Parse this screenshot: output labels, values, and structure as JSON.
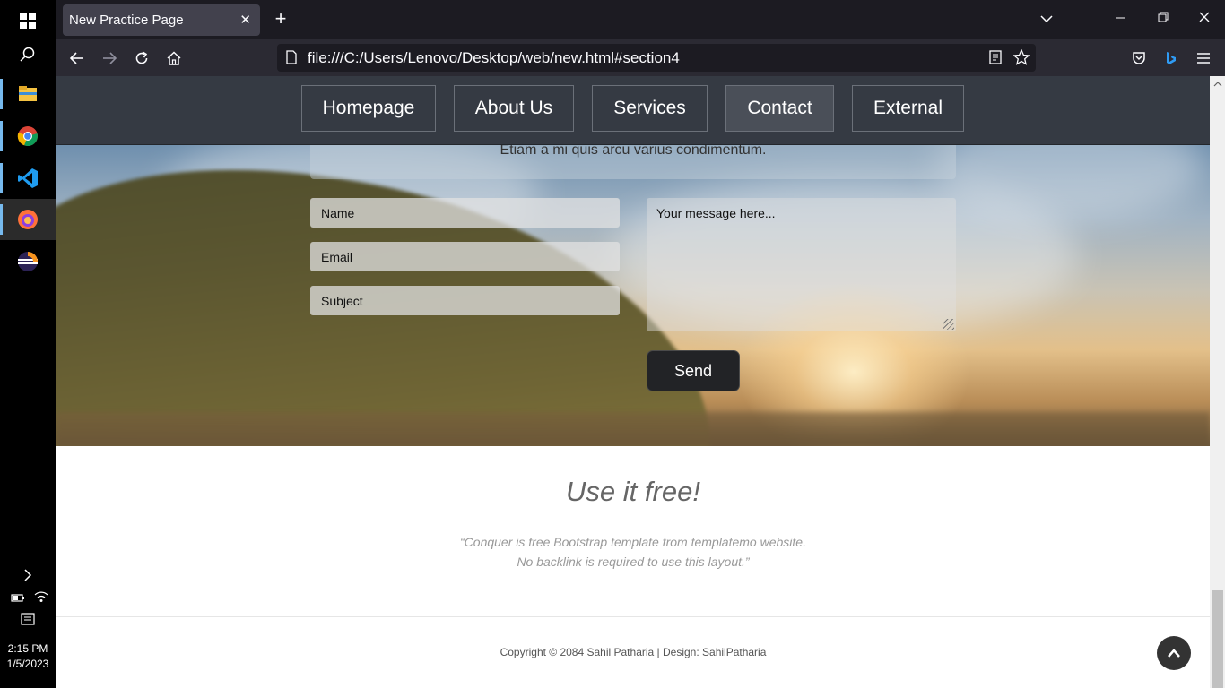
{
  "browser": {
    "tab_title": "New Practice Page",
    "tab_close": "✕",
    "new_tab": "+",
    "url": "file:///C:/Users/Lenovo/Desktop/web/new.html#section4"
  },
  "taskbar": {
    "time": "2:15 PM",
    "date": "1/5/2023"
  },
  "page": {
    "nav": {
      "items": [
        {
          "label": "Homepage"
        },
        {
          "label": "About Us"
        },
        {
          "label": "Services"
        },
        {
          "label": "Contact"
        },
        {
          "label": "External"
        }
      ],
      "active": "Contact"
    },
    "contact": {
      "intro_text": "Etiam a mi quis arcu varius condimentum.",
      "name_placeholder": "Name",
      "email_placeholder": "Email",
      "subject_placeholder": "Subject",
      "message_placeholder": "Your message here...",
      "send_label": "Send"
    },
    "free": {
      "title": "Use it free!",
      "quote_line1": "“Conquer is free Bootstrap template from templatemo website.",
      "quote_line2": "No backlink is required to use this layout.”"
    },
    "footer": {
      "copyright": "Copyright © 2084 Sahil Patharia | Design: SahilPatharia"
    }
  },
  "colors": {
    "nav_bg": "#353a43",
    "button_dark": "#222326",
    "browser_bg": "#1c1b22"
  }
}
